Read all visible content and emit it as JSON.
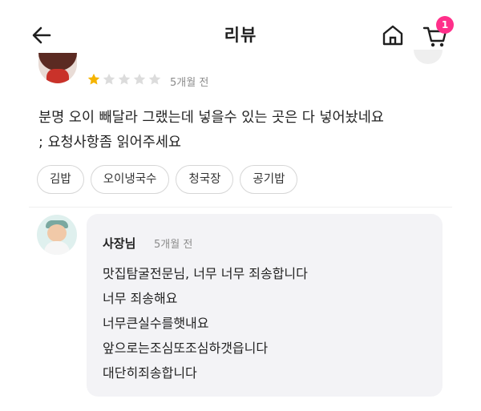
{
  "header": {
    "title": "리뷰",
    "cart_badge": "1"
  },
  "review": {
    "rating": 1,
    "max_rating": 5,
    "date": "5개월 전",
    "text_line1": "분명 오이 빼달라 그랬는데 넣을수 있는 곳은 다 넣어놨네요",
    "text_line2": "; 요청사항좀 읽어주세요",
    "tags": [
      "김밥",
      "오이냉국수",
      "청국장",
      "공기밥"
    ]
  },
  "reply": {
    "author": "사장님",
    "date": "5개월 전",
    "lines": [
      "맛집탐굴전문님, 너무 너무 죄송합니다",
      "너무 죄송해요",
      "너무큰실수를햇내요",
      "앞으로는조심또조심하갯읍니다",
      "대단히죄송합니다"
    ]
  },
  "colors": {
    "star_filled": "#f5b400",
    "star_empty": "#dcdcdc",
    "badge": "#ff2f8a",
    "bubble": "#f3f3f6"
  },
  "icons": {
    "back": "arrow-left-icon",
    "home": "home-icon",
    "cart": "cart-icon",
    "star": "star-icon"
  }
}
